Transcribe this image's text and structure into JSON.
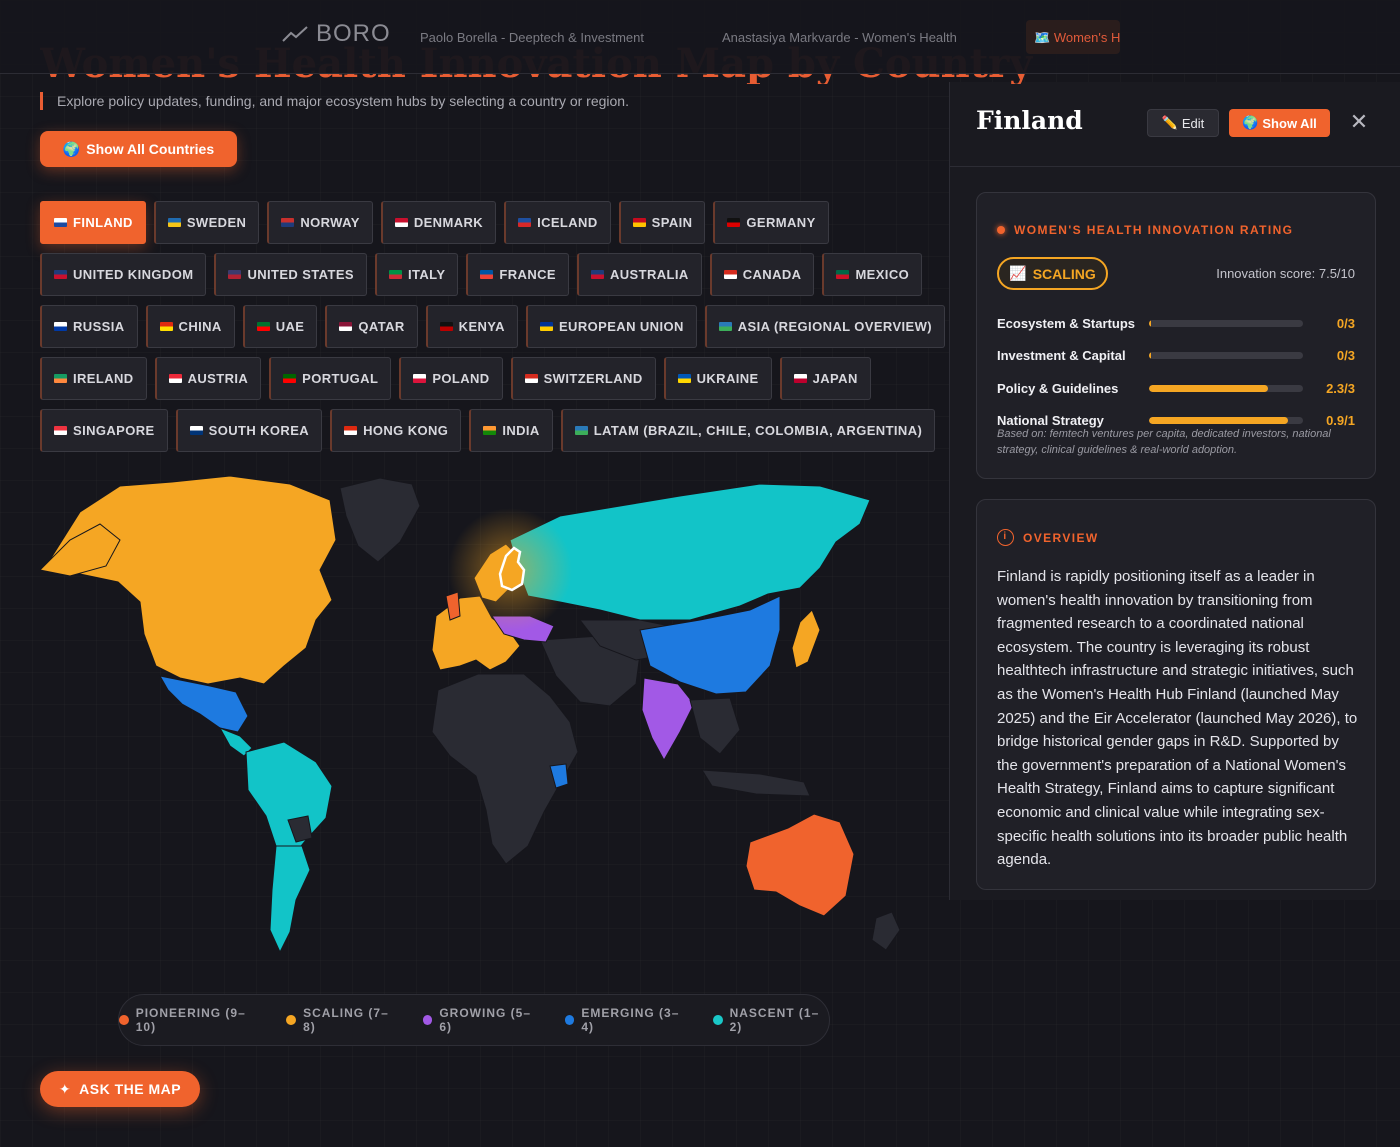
{
  "topbar": {
    "logo": "BORO",
    "tabs": [
      "Paolo Borella - Deeptech & Investment",
      "Anastasiya Markvarde - Women's Health"
    ],
    "active_tab": "Women's H"
  },
  "page": {
    "title": "Women's Health Innovation Map by Country",
    "subtitle": "Explore policy updates, funding, and major ecosystem hubs by selecting a country or region.",
    "show_all_countries": "Show All Countries",
    "ask_the_map": "ASK THE MAP"
  },
  "chips": [
    [
      {
        "label": "FINLAND",
        "flag": [
          "#ffffff",
          "#1d4aa0"
        ],
        "active": true
      },
      {
        "label": "SWEDEN",
        "flag": [
          "#1f6bb0",
          "#f5c518"
        ]
      },
      {
        "label": "NORWAY",
        "flag": [
          "#c8302d",
          "#1f3b7a"
        ]
      },
      {
        "label": "DENMARK",
        "flag": [
          "#c8102e",
          "#ffffff"
        ]
      },
      {
        "label": "ICELAND",
        "flag": [
          "#1e4fa0",
          "#d72828"
        ]
      },
      {
        "label": "SPAIN",
        "flag": [
          "#c60b1e",
          "#ffc400"
        ]
      },
      {
        "label": "GERMANY",
        "flag": [
          "#111111",
          "#dd0000"
        ]
      }
    ],
    [
      {
        "label": "UNITED KINGDOM",
        "flag": [
          "#1f3b7a",
          "#c8102e"
        ]
      },
      {
        "label": "UNITED STATES",
        "flag": [
          "#3c3b6e",
          "#b22234"
        ]
      },
      {
        "label": "ITALY",
        "flag": [
          "#009246",
          "#ce2b37"
        ]
      },
      {
        "label": "FRANCE",
        "flag": [
          "#0055a4",
          "#ef4135"
        ]
      },
      {
        "label": "AUSTRALIA",
        "flag": [
          "#1f3b7a",
          "#c8102e"
        ]
      },
      {
        "label": "CANADA",
        "flag": [
          "#d52b1e",
          "#ffffff"
        ]
      },
      {
        "label": "MEXICO",
        "flag": [
          "#006847",
          "#ce1126"
        ]
      }
    ],
    [
      {
        "label": "RUSSIA",
        "flag": [
          "#ffffff",
          "#0039a6"
        ]
      },
      {
        "label": "CHINA",
        "flag": [
          "#de2910",
          "#ffde00"
        ]
      },
      {
        "label": "UAE",
        "flag": [
          "#00732f",
          "#ff0000"
        ]
      },
      {
        "label": "QATAR",
        "flag": [
          "#8a1538",
          "#ffffff"
        ]
      },
      {
        "label": "KENYA",
        "flag": [
          "#111111",
          "#bb0000"
        ]
      },
      {
        "label": "EUROPEAN UNION",
        "flag": [
          "#003399",
          "#ffcc00"
        ]
      },
      {
        "label": "ASIA (REGIONAL OVERVIEW)",
        "flag": [
          "#2a7ab8",
          "#3cae5a"
        ]
      }
    ],
    [
      {
        "label": "IRELAND",
        "flag": [
          "#169b62",
          "#ff883e"
        ]
      },
      {
        "label": "AUSTRIA",
        "flag": [
          "#ed2939",
          "#ffffff"
        ]
      },
      {
        "label": "PORTUGAL",
        "flag": [
          "#006600",
          "#ff0000"
        ]
      },
      {
        "label": "POLAND",
        "flag": [
          "#ffffff",
          "#dc143c"
        ]
      },
      {
        "label": "SWITZERLAND",
        "flag": [
          "#d52b1e",
          "#ffffff"
        ]
      },
      {
        "label": "UKRAINE",
        "flag": [
          "#0057b7",
          "#ffd700"
        ]
      },
      {
        "label": "JAPAN",
        "flag": [
          "#ffffff",
          "#bc002d"
        ]
      }
    ],
    [
      {
        "label": "SINGAPORE",
        "flag": [
          "#ef3340",
          "#ffffff"
        ]
      },
      {
        "label": "SOUTH KOREA",
        "flag": [
          "#ffffff",
          "#003478"
        ]
      },
      {
        "label": "HONG KONG",
        "flag": [
          "#de2910",
          "#ffffff"
        ]
      },
      {
        "label": "INDIA",
        "flag": [
          "#ff9933",
          "#138808"
        ]
      },
      {
        "label": "LATAM (BRAZIL, CHILE, COLOMBIA, ARGENTINA)",
        "flag": [
          "#2a7ab8",
          "#3cae5a"
        ]
      }
    ]
  ],
  "legend": [
    {
      "label": "PIONEERING (9–10)",
      "color": "#f0632d"
    },
    {
      "label": "SCALING (7–8)",
      "color": "#f5a623"
    },
    {
      "label": "GROWING (5–6)",
      "color": "#a259e6"
    },
    {
      "label": "EMERGING (3–4)",
      "color": "#1e7ae0"
    },
    {
      "label": "NASCENT (1–2)",
      "color": "#1ac8c8"
    }
  ],
  "map_colors": {
    "pioneering": "#f0632d",
    "scaling": "#f5a623",
    "growing": "#a259e6",
    "emerging": "#1e7ae0",
    "nascent": "#12c4c8",
    "unrated": "#2a2b33"
  },
  "panel": {
    "title": "Finland",
    "edit": "Edit",
    "show_all": "Show All",
    "rating_heading": "WOMEN'S HEALTH INNOVATION RATING",
    "badge": "SCALING",
    "score": "Innovation score: 7.5/10",
    "metrics": [
      {
        "label": "Ecosystem & Startups",
        "value": "0/3",
        "fraction": 0.0
      },
      {
        "label": "Investment & Capital",
        "value": "0/3",
        "fraction": 0.0
      },
      {
        "label": "Policy & Guidelines",
        "value": "2.3/3",
        "fraction": 0.77
      },
      {
        "label": "National Strategy",
        "value": "0.9/1",
        "fraction": 0.9
      }
    ],
    "based_on": "Based on: femtech ventures per capita, dedicated investors, national strategy, clinical guidelines & real-world adoption.",
    "overview_heading": "OVERVIEW",
    "overview": "Finland is rapidly positioning itself as a leader in women's health innovation by transitioning from fragmented research to a coordinated national ecosystem. The country is leveraging its robust healthtech infrastructure and strategic initiatives, such as the Women's Health Hub Finland (launched May 2025) and the Eir Accelerator (launched May 2026), to bridge historical gender gaps in R&D. Supported by the government's preparation of a National Women's Health Strategy, Finland aims to capture significant economic and clinical value while integrating sex-specific health solutions into its broader public health agenda."
  }
}
